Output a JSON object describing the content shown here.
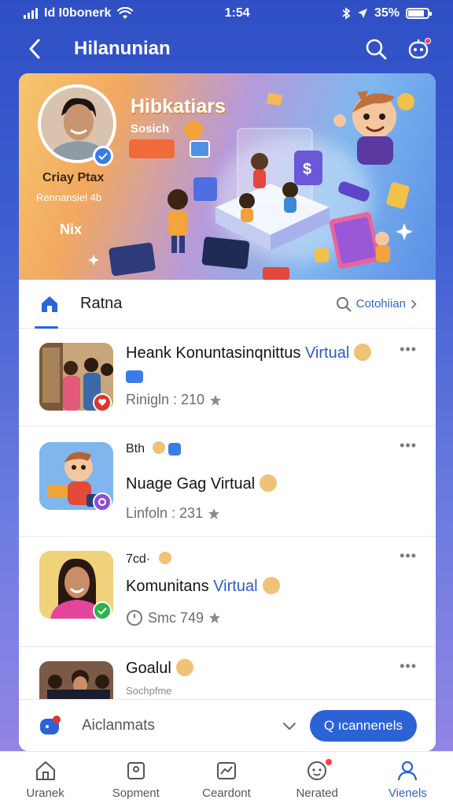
{
  "status_bar": {
    "carrier": "Id I0bonerk",
    "time": "1:54",
    "battery_text": "35%",
    "battery_level": 0.85
  },
  "header": {
    "title": "Hilanunian",
    "back_icon": "chevron-left-icon",
    "search_icon": "search-icon",
    "notify_icon": "bot-icon"
  },
  "banner": {
    "title": "Hibkatiars",
    "chip": "Sosich",
    "user_name": "Criay Ptax",
    "user_sub": "Rennansiel 4b",
    "tag": "Nix"
  },
  "tabs": {
    "active_label": "Ratna",
    "search_label": "Cotohiian"
  },
  "items": [
    {
      "title": "Heank Konuntasinqnittus",
      "title_accent": "Virtual",
      "meta": "Rinigln : 210",
      "more": "•••",
      "badge_color": "#e0342c"
    },
    {
      "small": "Bth",
      "title": "Nuage Gag",
      "title_accent": "Virtual",
      "meta": "Linfoln : 231",
      "more": "•••",
      "badge_color": "#8a4fd6"
    },
    {
      "small": "7cd·",
      "title": "Komunitans",
      "title_accent": "Virtual",
      "meta": "Smc 749",
      "more": "•••",
      "badge_color": "#2bb44a"
    },
    {
      "title": "Goalul",
      "meta": "Sochpfme",
      "more": "•••"
    }
  ],
  "action_row": {
    "label": "Aiclanmats",
    "button_label": "Q ıcannenels"
  },
  "bottom_nav": [
    {
      "label": "Uranek",
      "icon": "home-icon"
    },
    {
      "label": "Sopment",
      "icon": "square-icon"
    },
    {
      "label": "Ceardont",
      "icon": "chart-icon"
    },
    {
      "label": "Nerated",
      "icon": "bell-icon"
    },
    {
      "label": "Vienels",
      "icon": "user-icon"
    }
  ]
}
